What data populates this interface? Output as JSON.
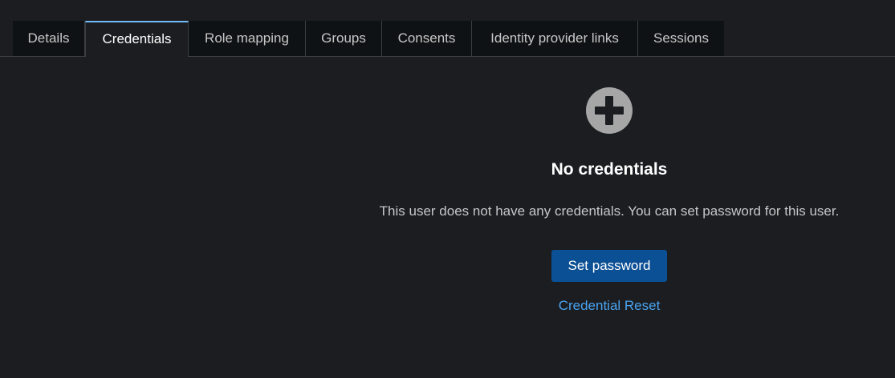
{
  "tabs": [
    {
      "label": "Details",
      "active": false
    },
    {
      "label": "Credentials",
      "active": true
    },
    {
      "label": "Role mapping",
      "active": false
    },
    {
      "label": "Groups",
      "active": false
    },
    {
      "label": "Consents",
      "active": false
    },
    {
      "label": "Identity provider links",
      "active": false
    },
    {
      "label": "Sessions",
      "active": false
    }
  ],
  "empty_state": {
    "icon": "plus-circle-icon",
    "title": "No credentials",
    "body": "This user does not have any credentials. You can set password for this user.",
    "primary_action": "Set password",
    "secondary_action": "Credential Reset"
  },
  "colors": {
    "background": "#1b1d21",
    "tab_bg": "#0f1214",
    "active_tab_accent": "#73bcf7",
    "primary_button": "#0b4f94",
    "link": "#4aa3ef",
    "icon": "#a6a6a6"
  }
}
